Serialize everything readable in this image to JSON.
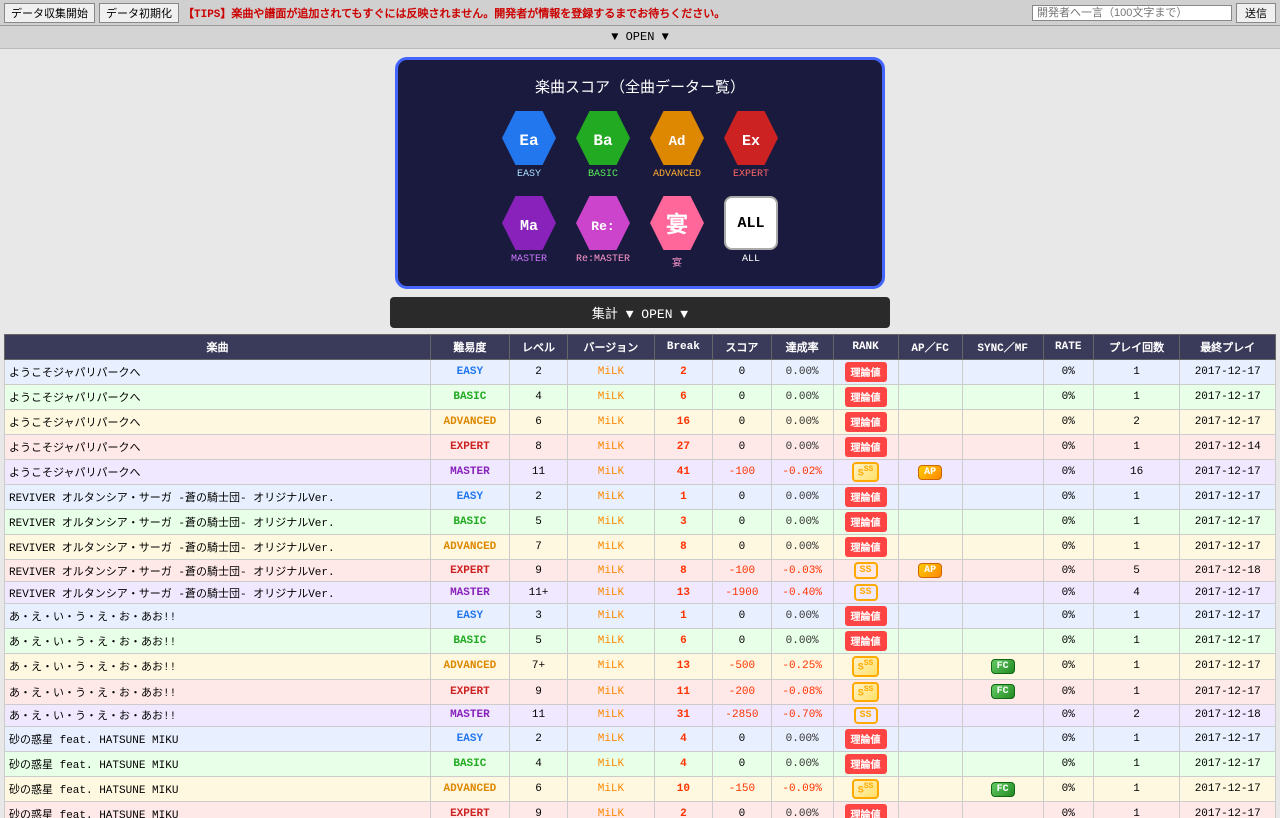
{
  "topbar": {
    "btn_collect": "データ収集開始",
    "btn_init": "データ初期化",
    "tips": "【TIPS】楽曲や譜面が追加されてもすぐには反映されません。開発者が情報を登録するまでお待ちください。",
    "dev_placeholder": "開発者へ一言（100文字まで）",
    "btn_send": "送信"
  },
  "open_label": "▼ OPEN ▼",
  "score_panel": {
    "title": "楽曲スコア（全曲データー覧）",
    "difficulties": [
      {
        "id": "easy",
        "label": "EASY",
        "icon": "Ea",
        "color_class": "easy",
        "label_class": ""
      },
      {
        "id": "basic",
        "label": "BASIC",
        "icon": "Ba",
        "color_class": "basic",
        "label_class": "green"
      },
      {
        "id": "advanced",
        "label": "ADVANCED",
        "icon": "Ad",
        "color_class": "advanced",
        "label_class": "orange"
      },
      {
        "id": "expert",
        "label": "EXPERT",
        "icon": "Ex",
        "color_class": "expert",
        "label_class": "red"
      }
    ],
    "difficulties2": [
      {
        "id": "master",
        "label": "MASTER",
        "icon": "Ma",
        "color_class": "master",
        "label_class": "purple"
      },
      {
        "id": "remaster",
        "label": "Re:MASTER",
        "icon": "Re:",
        "color_class": "remaster",
        "label_class": "pink"
      },
      {
        "id": "utage",
        "label": "宴",
        "icon": "宴",
        "color_class": "utage",
        "label_class": "pink"
      },
      {
        "id": "all",
        "label": "ALL",
        "icon": "ALL",
        "color_class": "all",
        "label_class": "white"
      }
    ]
  },
  "summary_label": "集計 ▼ OPEN ▼",
  "table": {
    "headers": [
      "楽曲",
      "難易度",
      "レベル",
      "バージョン",
      "Break",
      "スコア",
      "達成率",
      "RANK",
      "AP／FC",
      "SYNC／MF",
      "RATE",
      "プレイ回数",
      "最終プレイ"
    ],
    "rows": [
      {
        "song": "ようこそジャパリパークへ",
        "diff": "EASY",
        "diff_class": "diff-easy",
        "row_class": "row-easy",
        "level": "2",
        "version": "MiLK",
        "break": "2",
        "score": "0",
        "rate": "0.00%",
        "rank": "riron",
        "ap": "",
        "fc": "",
        "sync": "",
        "rate_val": "0%",
        "plays": "1",
        "last": "2017-12-17"
      },
      {
        "song": "ようこそジャパリパークへ",
        "diff": "BASIC",
        "diff_class": "diff-basic",
        "row_class": "row-basic",
        "level": "4",
        "version": "MiLK",
        "break": "6",
        "score": "0",
        "rate": "0.00%",
        "rank": "riron",
        "ap": "",
        "fc": "",
        "sync": "",
        "rate_val": "0%",
        "plays": "1",
        "last": "2017-12-17"
      },
      {
        "song": "ようこそジャパリパークへ",
        "diff": "ADVANCED",
        "diff_class": "diff-advanced",
        "row_class": "row-advanced",
        "level": "6",
        "version": "MiLK",
        "break": "16",
        "score": "0",
        "rate": "0.00%",
        "rank": "riron",
        "ap": "",
        "fc": "",
        "sync": "",
        "rate_val": "0%",
        "plays": "2",
        "last": "2017-12-17"
      },
      {
        "song": "ようこそジャパリパークへ",
        "diff": "EXPERT",
        "diff_class": "diff-expert",
        "row_class": "row-expert",
        "level": "8",
        "version": "MiLK",
        "break": "27",
        "score": "0",
        "rate": "0.00%",
        "rank": "riron",
        "ap": "",
        "fc": "",
        "sync": "",
        "rate_val": "0%",
        "plays": "1",
        "last": "2017-12-14"
      },
      {
        "song": "ようこそジャパリパークへ",
        "diff": "MASTER",
        "diff_class": "diff-master",
        "row_class": "row-master",
        "level": "11",
        "version": "MiLK",
        "break": "41",
        "score": "-100",
        "rate": "-0.02%",
        "rank": "sss",
        "ap": "ap",
        "fc": "",
        "sync": "",
        "rate_val": "0%",
        "plays": "16",
        "last": "2017-12-17"
      },
      {
        "song": "REVIVER オルタンシア・サーガ -蒼の騎士団- オリジナルVer.",
        "diff": "EASY",
        "diff_class": "diff-easy",
        "row_class": "row-easy",
        "level": "2",
        "version": "MiLK",
        "break": "1",
        "score": "0",
        "rate": "0.00%",
        "rank": "riron",
        "ap": "",
        "fc": "",
        "sync": "",
        "rate_val": "0%",
        "plays": "1",
        "last": "2017-12-17"
      },
      {
        "song": "REVIVER オルタンシア・サーガ -蒼の騎士団- オリジナルVer.",
        "diff": "BASIC",
        "diff_class": "diff-basic",
        "row_class": "row-basic",
        "level": "5",
        "version": "MiLK",
        "break": "3",
        "score": "0",
        "rate": "0.00%",
        "rank": "riron",
        "ap": "",
        "fc": "",
        "sync": "",
        "rate_val": "0%",
        "plays": "1",
        "last": "2017-12-17"
      },
      {
        "song": "REVIVER オルタンシア・サーガ -蒼の騎士団- オリジナルVer.",
        "diff": "ADVANCED",
        "diff_class": "diff-advanced",
        "row_class": "row-advanced",
        "level": "7",
        "version": "MiLK",
        "break": "8",
        "score": "0",
        "rate": "0.00%",
        "rank": "riron",
        "ap": "",
        "fc": "",
        "sync": "",
        "rate_val": "0%",
        "plays": "1",
        "last": "2017-12-17"
      },
      {
        "song": "REVIVER オルタンシア・サーガ -蒼の騎士団- オリジナルVer.",
        "diff": "EXPERT",
        "diff_class": "diff-expert",
        "row_class": "row-expert",
        "level": "9",
        "version": "MiLK",
        "break": "8",
        "score": "-100",
        "rate": "-0.03%",
        "rank": "ss",
        "ap": "ap",
        "fc": "",
        "sync": "",
        "rate_val": "0%",
        "plays": "5",
        "last": "2017-12-18"
      },
      {
        "song": "REVIVER オルタンシア・サーガ -蒼の騎士団- オリジナルVer.",
        "diff": "MASTER",
        "diff_class": "diff-master",
        "row_class": "row-master",
        "level": "11+",
        "version": "MiLK",
        "break": "13",
        "score": "-1900",
        "rate": "-0.40%",
        "rank": "ss",
        "ap": "",
        "fc": "",
        "sync": "",
        "rate_val": "0%",
        "plays": "4",
        "last": "2017-12-17"
      },
      {
        "song": "あ・え・い・う・え・お・あお!!",
        "diff": "EASY",
        "diff_class": "diff-easy",
        "row_class": "row-easy",
        "level": "3",
        "version": "MiLK",
        "break": "1",
        "score": "0",
        "rate": "0.00%",
        "rank": "riron",
        "ap": "",
        "fc": "",
        "sync": "",
        "rate_val": "0%",
        "plays": "1",
        "last": "2017-12-17"
      },
      {
        "song": "あ・え・い・う・え・お・あお!!",
        "diff": "BASIC",
        "diff_class": "diff-basic",
        "row_class": "row-basic",
        "level": "5",
        "version": "MiLK",
        "break": "6",
        "score": "0",
        "rate": "0.00%",
        "rank": "riron",
        "ap": "",
        "fc": "",
        "sync": "",
        "rate_val": "0%",
        "plays": "1",
        "last": "2017-12-17"
      },
      {
        "song": "あ・え・い・う・え・お・あお!!",
        "diff": "ADVANCED",
        "diff_class": "diff-advanced",
        "row_class": "row-advanced",
        "level": "7+",
        "version": "MiLK",
        "break": "13",
        "score": "-500",
        "rate": "-0.25%",
        "rank": "sss",
        "ap": "",
        "fc": "fc",
        "sync": "",
        "rate_val": "0%",
        "plays": "1",
        "last": "2017-12-17"
      },
      {
        "song": "あ・え・い・う・え・お・あお!!",
        "diff": "EXPERT",
        "diff_class": "diff-expert",
        "row_class": "row-expert",
        "level": "9",
        "version": "MiLK",
        "break": "11",
        "score": "-200",
        "rate": "-0.08%",
        "rank": "sss",
        "ap": "",
        "fc": "fc",
        "sync": "",
        "rate_val": "0%",
        "plays": "1",
        "last": "2017-12-17"
      },
      {
        "song": "あ・え・い・う・え・お・あお!!",
        "diff": "MASTER",
        "diff_class": "diff-master",
        "row_class": "row-master",
        "level": "11",
        "version": "MiLK",
        "break": "31",
        "score": "-2850",
        "rate": "-0.70%",
        "rank": "ss",
        "ap": "",
        "fc": "",
        "sync": "",
        "rate_val": "0%",
        "plays": "2",
        "last": "2017-12-18"
      },
      {
        "song": "砂の惑星 feat. HATSUNE MIKU",
        "diff": "EASY",
        "diff_class": "diff-easy",
        "row_class": "row-easy",
        "level": "2",
        "version": "MiLK",
        "break": "4",
        "score": "0",
        "rate": "0.00%",
        "rank": "riron",
        "ap": "",
        "fc": "",
        "sync": "",
        "rate_val": "0%",
        "plays": "1",
        "last": "2017-12-17"
      },
      {
        "song": "砂の惑星 feat. HATSUNE MIKU",
        "diff": "BASIC",
        "diff_class": "diff-basic",
        "row_class": "row-basic",
        "level": "4",
        "version": "MiLK",
        "break": "4",
        "score": "0",
        "rate": "0.00%",
        "rank": "riron",
        "ap": "",
        "fc": "",
        "sync": "",
        "rate_val": "0%",
        "plays": "1",
        "last": "2017-12-17"
      },
      {
        "song": "砂の惑星 feat. HATSUNE MIKU",
        "diff": "ADVANCED",
        "diff_class": "diff-advanced",
        "row_class": "row-advanced",
        "level": "6",
        "version": "MiLK",
        "break": "10",
        "score": "-150",
        "rate": "-0.09%",
        "rank": "sss",
        "ap": "",
        "fc": "fc",
        "sync": "",
        "rate_val": "0%",
        "plays": "1",
        "last": "2017-12-17"
      },
      {
        "song": "砂の惑星 feat. HATSUNE MIKU",
        "diff": "EXPERT",
        "diff_class": "diff-expert",
        "row_class": "row-expert",
        "level": "9",
        "version": "MiLK",
        "break": "2",
        "score": "0",
        "rate": "0.00%",
        "rank": "riron",
        "ap": "",
        "fc": "",
        "sync": "",
        "rate_val": "0%",
        "plays": "1",
        "last": "2017-12-17"
      }
    ]
  }
}
